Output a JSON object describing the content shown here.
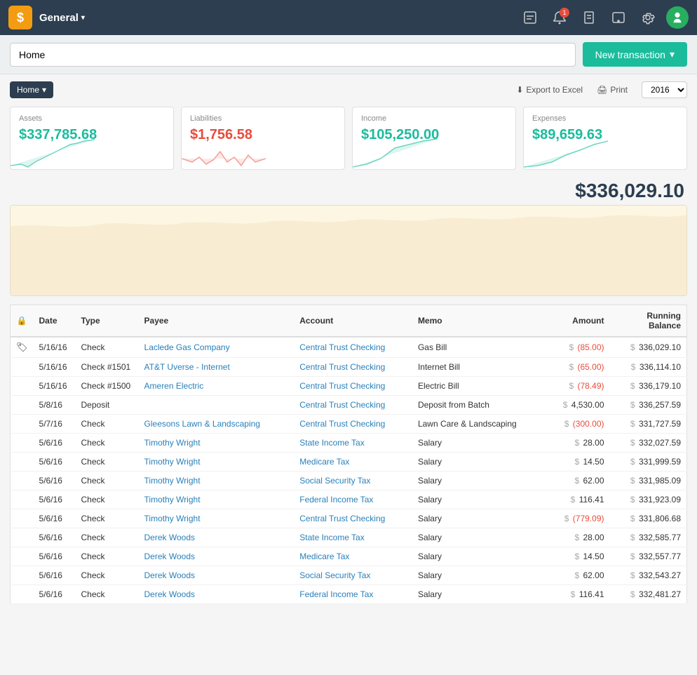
{
  "app": {
    "logo": "$",
    "title": "General",
    "caret": "▾"
  },
  "nav": {
    "notification_count": "1"
  },
  "search": {
    "value": "Home",
    "placeholder": "Home"
  },
  "new_transaction": {
    "label": "New transaction",
    "caret": "▾"
  },
  "toolbar": {
    "home_label": "Home",
    "home_caret": "▾",
    "export_label": "Export to Excel",
    "print_label": "Print",
    "year_label": "2016",
    "year_caret": "▾"
  },
  "summary_cards": [
    {
      "label": "Assets",
      "value": "$337,785.68",
      "color": "green"
    },
    {
      "label": "Liabilities",
      "value": "$1,756.58",
      "color": "red"
    },
    {
      "label": "Income",
      "value": "$105,250.00",
      "color": "green"
    },
    {
      "label": "Expenses",
      "value": "$89,659.63",
      "color": "green"
    }
  ],
  "net_value": "$336,029.10",
  "table": {
    "headers": [
      "🔒",
      "Date",
      "Type",
      "Payee",
      "Account",
      "Memo",
      "Amount",
      "Running Balance"
    ],
    "rows": [
      {
        "flag": "🏷",
        "date": "5/16/16",
        "type": "Check",
        "payee": "Laclede Gas Company",
        "account": "Central Trust Checking",
        "memo": "Gas Bill",
        "amount_sign": "-",
        "amount": "(85.00)",
        "amount_color": "red",
        "balance": "336,029.10"
      },
      {
        "flag": "",
        "date": "5/16/16",
        "type": "Check #1501",
        "payee": "AT&T Uverse - Internet",
        "account": "Central Trust Checking",
        "memo": "Internet Bill",
        "amount_sign": "-",
        "amount": "(65.00)",
        "amount_color": "red",
        "balance": "336,114.10"
      },
      {
        "flag": "",
        "date": "5/16/16",
        "type": "Check #1500",
        "payee": "Ameren Electric",
        "account": "Central Trust Checking",
        "memo": "Electric Bill",
        "amount_sign": "-",
        "amount": "(78.49)",
        "amount_color": "red",
        "balance": "336,179.10"
      },
      {
        "flag": "",
        "date": "5/8/16",
        "type": "Deposit",
        "payee": "",
        "account": "Central Trust Checking",
        "memo": "Deposit from Batch",
        "amount_sign": "+",
        "amount": "4,530.00",
        "amount_color": "black",
        "balance": "336,257.59"
      },
      {
        "flag": "",
        "date": "5/7/16",
        "type": "Check",
        "payee": "Gleesons Lawn & Landscaping",
        "account": "Central Trust Checking",
        "memo": "Lawn Care & Landscaping",
        "amount_sign": "-",
        "amount": "(300.00)",
        "amount_color": "red",
        "balance": "331,727.59"
      },
      {
        "flag": "",
        "date": "5/6/16",
        "type": "Check",
        "payee": "Timothy Wright",
        "account": "State Income Tax",
        "memo": "Salary",
        "amount_sign": "+",
        "amount": "28.00",
        "amount_color": "black",
        "balance": "332,027.59"
      },
      {
        "flag": "",
        "date": "5/6/16",
        "type": "Check",
        "payee": "Timothy Wright",
        "account": "Medicare Tax",
        "memo": "Salary",
        "amount_sign": "+",
        "amount": "14.50",
        "amount_color": "black",
        "balance": "331,999.59"
      },
      {
        "flag": "",
        "date": "5/6/16",
        "type": "Check",
        "payee": "Timothy Wright",
        "account": "Social Security Tax",
        "memo": "Salary",
        "amount_sign": "+",
        "amount": "62.00",
        "amount_color": "black",
        "balance": "331,985.09"
      },
      {
        "flag": "",
        "date": "5/6/16",
        "type": "Check",
        "payee": "Timothy Wright",
        "account": "Federal Income Tax",
        "memo": "Salary",
        "amount_sign": "+",
        "amount": "116.41",
        "amount_color": "black",
        "balance": "331,923.09"
      },
      {
        "flag": "",
        "date": "5/6/16",
        "type": "Check",
        "payee": "Timothy Wright",
        "account": "Central Trust Checking",
        "memo": "Salary",
        "amount_sign": "-",
        "amount": "(779.09)",
        "amount_color": "red",
        "balance": "331,806.68"
      },
      {
        "flag": "",
        "date": "5/6/16",
        "type": "Check",
        "payee": "Derek Woods",
        "account": "State Income Tax",
        "memo": "Salary",
        "amount_sign": "+",
        "amount": "28.00",
        "amount_color": "black",
        "balance": "332,585.77"
      },
      {
        "flag": "",
        "date": "5/6/16",
        "type": "Check",
        "payee": "Derek Woods",
        "account": "Medicare Tax",
        "memo": "Salary",
        "amount_sign": "+",
        "amount": "14.50",
        "amount_color": "black",
        "balance": "332,557.77"
      },
      {
        "flag": "",
        "date": "5/6/16",
        "type": "Check",
        "payee": "Derek Woods",
        "account": "Social Security Tax",
        "memo": "Salary",
        "amount_sign": "+",
        "amount": "62.00",
        "amount_color": "black",
        "balance": "332,543.27"
      },
      {
        "flag": "",
        "date": "5/6/16",
        "type": "Check",
        "payee": "Derek Woods",
        "account": "Federal Income Tax",
        "memo": "Salary",
        "amount_sign": "+",
        "amount": "116.41",
        "amount_color": "black",
        "balance": "332,481.27"
      }
    ]
  }
}
